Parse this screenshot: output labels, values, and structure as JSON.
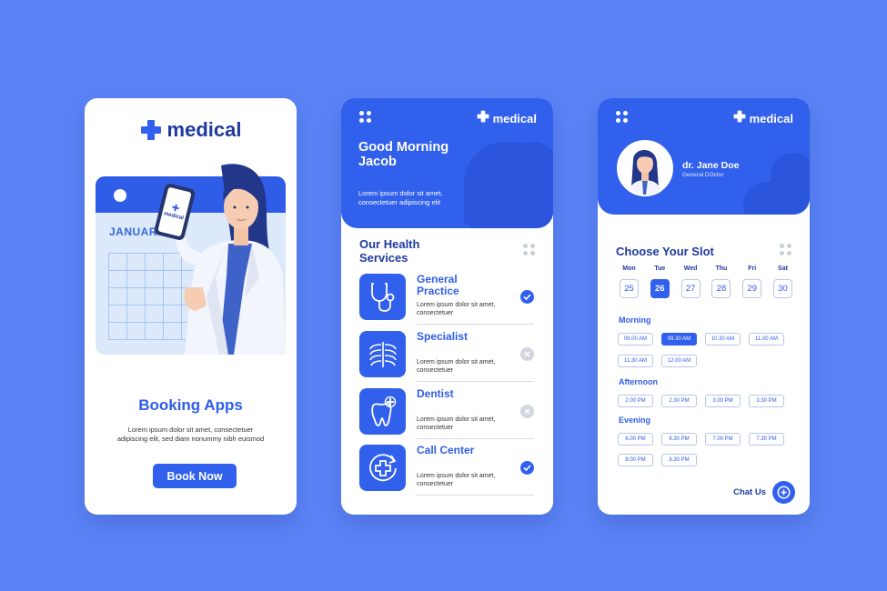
{
  "screen1": {
    "brand": "medical",
    "calendar_month": "JANUARY",
    "phone_brand": "medical",
    "title": "Booking Apps",
    "description": "Lorem ipsum dolor sit amet, consectetuer adipiscing elit, sed diam nonummy nibh euismod",
    "button_label": "Book Now"
  },
  "screen2": {
    "brand": "medical",
    "greeting": "Good Morning Jacob",
    "greeting_desc": "Lorem ipsum dolor sit amet, consectetuer adipiscing elit",
    "section_title": "Our Health Services",
    "services": [
      {
        "name": "General Practice",
        "desc": "Lorem ipsum dolor sit amet, consectetuer",
        "icon": "stethoscope-icon",
        "selected": true
      },
      {
        "name": "Specialist",
        "desc": "Lorem ipsum dolor sit amet, consectetuer",
        "icon": "ribcage-icon",
        "selected": false
      },
      {
        "name": "Dentist",
        "desc": "Lorem ipsum dolor sit amet, consectetuer",
        "icon": "tooth-icon",
        "selected": false
      },
      {
        "name": "Call Center",
        "desc": "Lorem ipsum dolor sit amet, consectetuer",
        "icon": "call-center-icon",
        "selected": true
      }
    ]
  },
  "screen3": {
    "brand": "medical",
    "doctor_name": "dr. Jane Doe",
    "doctor_role": "General DOctor",
    "section_title": "Choose Your Slot",
    "days": [
      {
        "name": "Mon",
        "num": "25"
      },
      {
        "name": "Tue",
        "num": "26"
      },
      {
        "name": "Wed",
        "num": "27"
      },
      {
        "name": "Thu",
        "num": "28"
      },
      {
        "name": "Fri",
        "num": "29"
      },
      {
        "name": "Sat",
        "num": "30"
      }
    ],
    "selected_day": "26",
    "morning_label": "Morning",
    "morning_slots": [
      "09.00 AM",
      "09.30 AM",
      "10.30 AM",
      "11.00 AM",
      "11.30 AM",
      "12.00 AM"
    ],
    "afternoon_label": "Afternoon",
    "afternoon_slots": [
      "2.00 PM",
      "2.30 PM",
      "3.00 PM",
      "3.30 PM"
    ],
    "evening_label": "Evening",
    "evening_slots": [
      "6.00 PM",
      "6.30 PM",
      "7.00 PM",
      "7.30 PM",
      "8.00 PM",
      "8.30 PM"
    ],
    "selected_slot": "09.30 AM",
    "chat_label": "Chat Us"
  },
  "colors": {
    "background": "#5b84f6",
    "primary": "#3160ec",
    "dark_text": "#1e3a9e"
  }
}
